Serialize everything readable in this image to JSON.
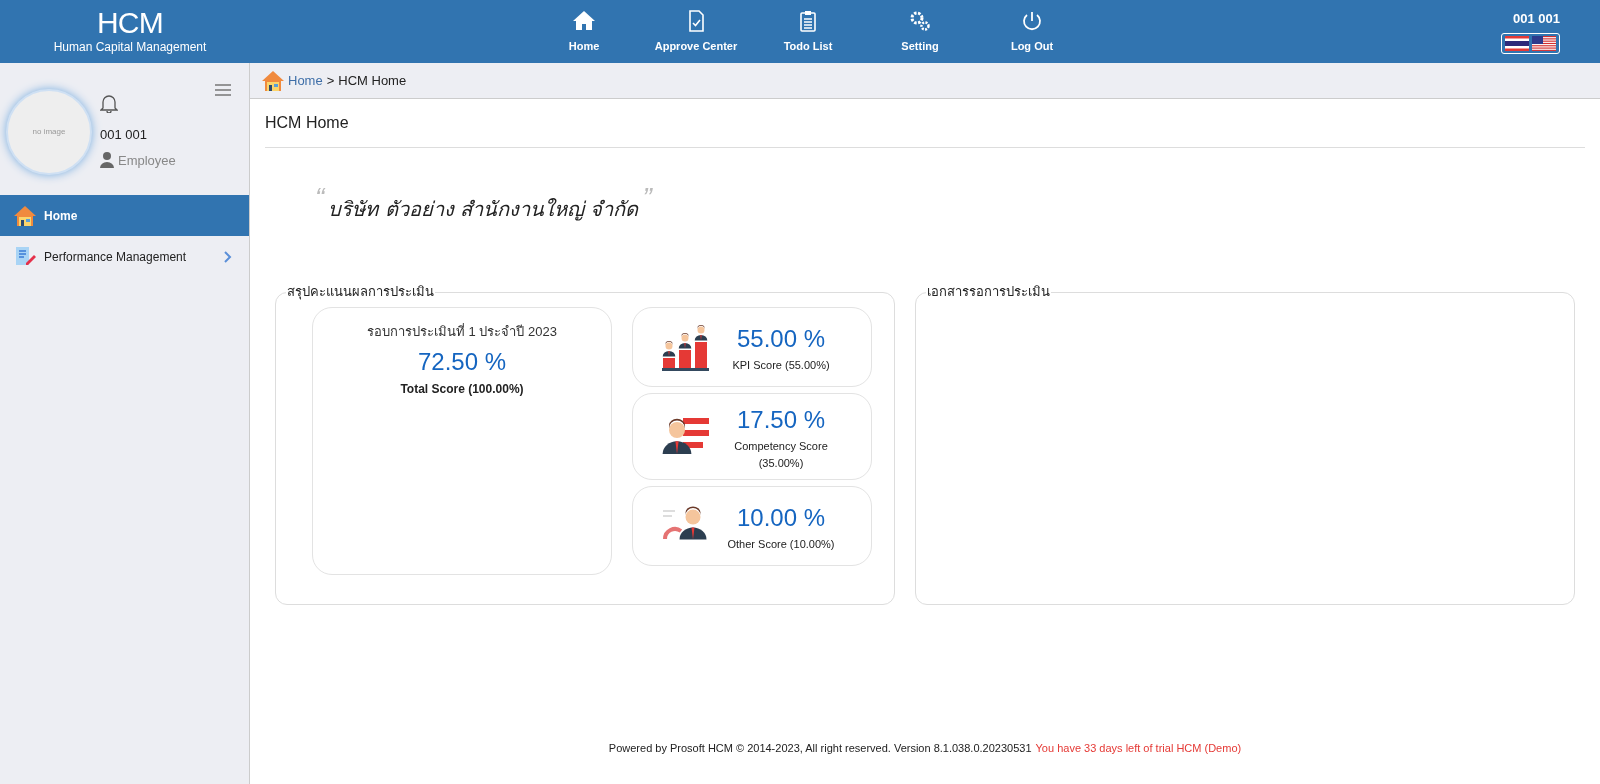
{
  "header": {
    "logo": "HCM",
    "subtitle": "Human Capital Management",
    "nav": [
      {
        "kind": "home",
        "label": "Home"
      },
      {
        "kind": "approve",
        "label": "Approve Center"
      },
      {
        "kind": "todo",
        "label": "Todo List"
      },
      {
        "kind": "setting",
        "label": "Setting"
      },
      {
        "kind": "logout",
        "label": "Log Out"
      }
    ],
    "user": "001 001"
  },
  "sidebar": {
    "avatar_text": "no image",
    "user_name": "001 001",
    "role": "Employee",
    "items": [
      {
        "kind": "home",
        "label": "Home",
        "selected": true,
        "has_children": false
      },
      {
        "kind": "performance",
        "label": "Performance Management",
        "selected": false,
        "has_children": true
      }
    ]
  },
  "breadcrumb": {
    "link": "Home",
    "separator": ">",
    "current": "HCM Home"
  },
  "page_title": "HCM Home",
  "company": {
    "open_quote": "“",
    "name": "บริษัท ตัวอย่าง สำนักงานใหญ่ จำกัด",
    "close_quote": "”"
  },
  "summary": {
    "title": "สรุปคะแนนผลการประเมิน",
    "round": "รอบการประเมินที่ 1 ประจำปี 2023",
    "total": "72.50 %",
    "total_label": "Total Score (100.00%)",
    "scores": [
      {
        "kind": "kpi",
        "value": "55.00 %",
        "label": "KPI Score (55.00%)"
      },
      {
        "kind": "competency",
        "value": "17.50 %",
        "label": "Competency Score (35.00%)"
      },
      {
        "kind": "other",
        "value": "10.00 %",
        "label": "Other Score (10.00%)"
      }
    ]
  },
  "documents": {
    "title": "เอกสารรอการประเมิน"
  },
  "footer": {
    "text": "Powered by Prosoft HCM © 2014-2023, All right reserved. Version 8.1.038.0.20230531",
    "trial": "You have 33 days left of trial HCM (Demo)"
  }
}
